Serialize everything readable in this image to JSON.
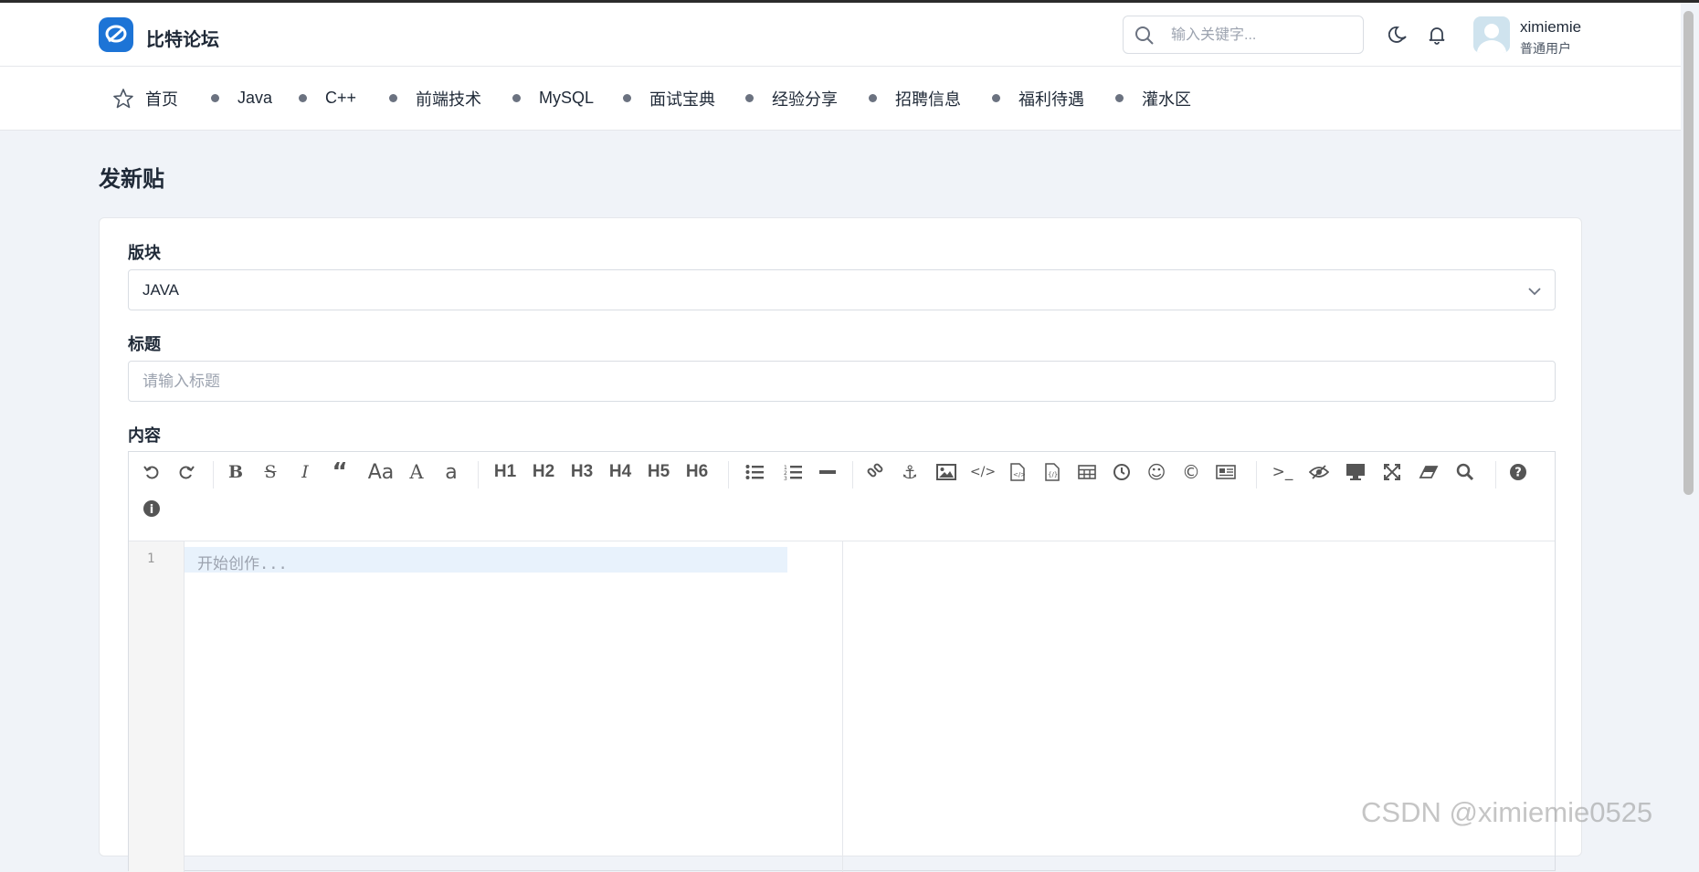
{
  "app": {
    "brand": "比特论坛",
    "colors": {
      "accent": "#1d74d6",
      "background": "#f0f3f8",
      "editor_active_line": "#e8f2fc"
    }
  },
  "header": {
    "search_placeholder": "输入关键字...",
    "user": {
      "name": "ximiemie",
      "role": "普通用户"
    },
    "icons": [
      "search-icon",
      "moon-icon",
      "bell-icon",
      "avatar"
    ]
  },
  "nav": {
    "home": "首页",
    "items": [
      "Java",
      "C++",
      "前端技术",
      "MySQL",
      "面试宝典",
      "经验分享",
      "招聘信息",
      "福利待遇",
      "灌水区"
    ]
  },
  "page": {
    "title": "发新贴"
  },
  "form": {
    "board_label": "版块",
    "board_value": "JAVA",
    "title_label": "标题",
    "title_placeholder": "请输入标题",
    "content_label": "内容"
  },
  "editor": {
    "headings": [
      "H1",
      "H2",
      "H3",
      "H4",
      "H5",
      "H6"
    ],
    "line_number": "1",
    "placeholder": "开始创作...",
    "toolbar_icons": [
      "undo-icon",
      "redo-icon",
      "bold-icon",
      "strikethrough-icon",
      "italic-icon",
      "quote-icon",
      "uppercase-icon",
      "uppercase-first-icon",
      "lowercase-icon",
      "unordered-list-icon",
      "ordered-list-icon",
      "hr-icon",
      "link-icon",
      "anchor-icon",
      "image-icon",
      "code-icon",
      "preformatted-code-icon",
      "code-block-icon",
      "table-icon",
      "datetime-icon",
      "emoji-icon",
      "html-entities-icon",
      "pagebreak-icon",
      "goto-line-icon",
      "unwatch-icon",
      "preview-icon",
      "fullscreen-icon",
      "clear-icon",
      "search-icon",
      "help-icon",
      "info-icon"
    ]
  },
  "watermark": "CSDN @ximiemie0525"
}
